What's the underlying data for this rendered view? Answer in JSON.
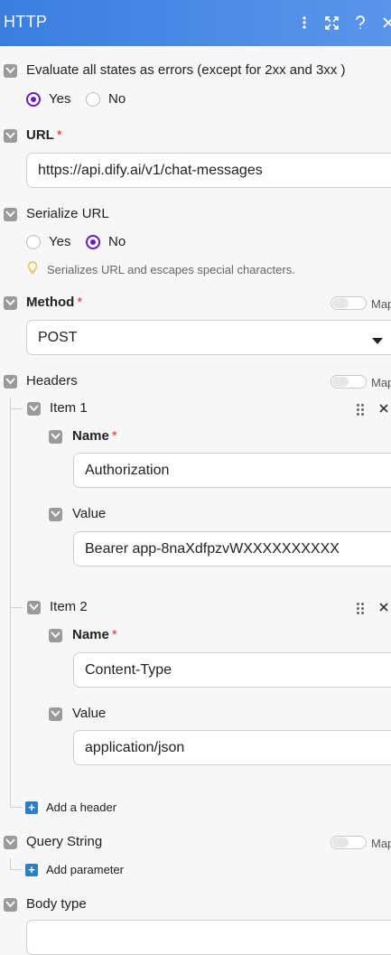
{
  "header": {
    "title": "HTTP"
  },
  "evaluate": {
    "label": "Evaluate all states as errors (except for 2xx and 3xx )",
    "yes": "Yes",
    "no": "No"
  },
  "url": {
    "label": "URL",
    "required": "*",
    "value": "https://api.dify.ai/v1/chat-messages"
  },
  "serialize": {
    "label": "Serialize URL",
    "yes": "Yes",
    "no": "No",
    "hint": "Serializes URL and escapes special characters."
  },
  "method": {
    "label": "Method",
    "required": "*",
    "map": "Map",
    "value": "POST"
  },
  "headers": {
    "label": "Headers",
    "map": "Map",
    "items": [
      {
        "title": "Item 1",
        "name_label": "Name",
        "name_value": "Authorization",
        "value_label": "Value",
        "value_value": "Bearer app-8naXdfpzvWXXXXXXXXXX"
      },
      {
        "title": "Item 2",
        "name_label": "Name",
        "name_value": "Content-Type",
        "value_label": "Value",
        "value_value": "application/json"
      }
    ],
    "add": "Add a header",
    "required": "*"
  },
  "query": {
    "label": "Query String",
    "map": "Map",
    "add": "Add parameter"
  },
  "body": {
    "label": "Body type"
  }
}
